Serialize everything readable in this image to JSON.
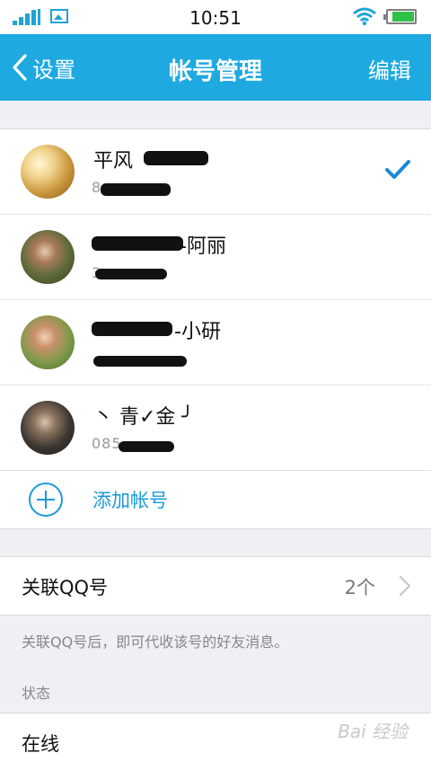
{
  "status_bar": {
    "time": "10:51"
  },
  "nav": {
    "back_label": "设置",
    "title": "帐号管理",
    "edit_label": "编辑"
  },
  "accounts": [
    {
      "name": "平风",
      "number": "8",
      "selected": true
    },
    {
      "name": "-阿丽",
      "number": "3",
      "selected": false
    },
    {
      "name": "-小研",
      "number": "",
      "selected": false
    },
    {
      "name": "丶 青✓金 ╯",
      "number": "085",
      "selected": false
    }
  ],
  "add_account_label": "添加帐号",
  "linked_qq": {
    "label": "关联QQ号",
    "count": "2个"
  },
  "linked_hint": "关联QQ号后，即可代收该号的好友消息。",
  "status_section": {
    "label": "状态",
    "value": "在线"
  },
  "watermark": "Bai 经验",
  "colors": {
    "accent": "#1ea9e1",
    "link": "#1a9ad6",
    "check": "#1a8ad0"
  }
}
